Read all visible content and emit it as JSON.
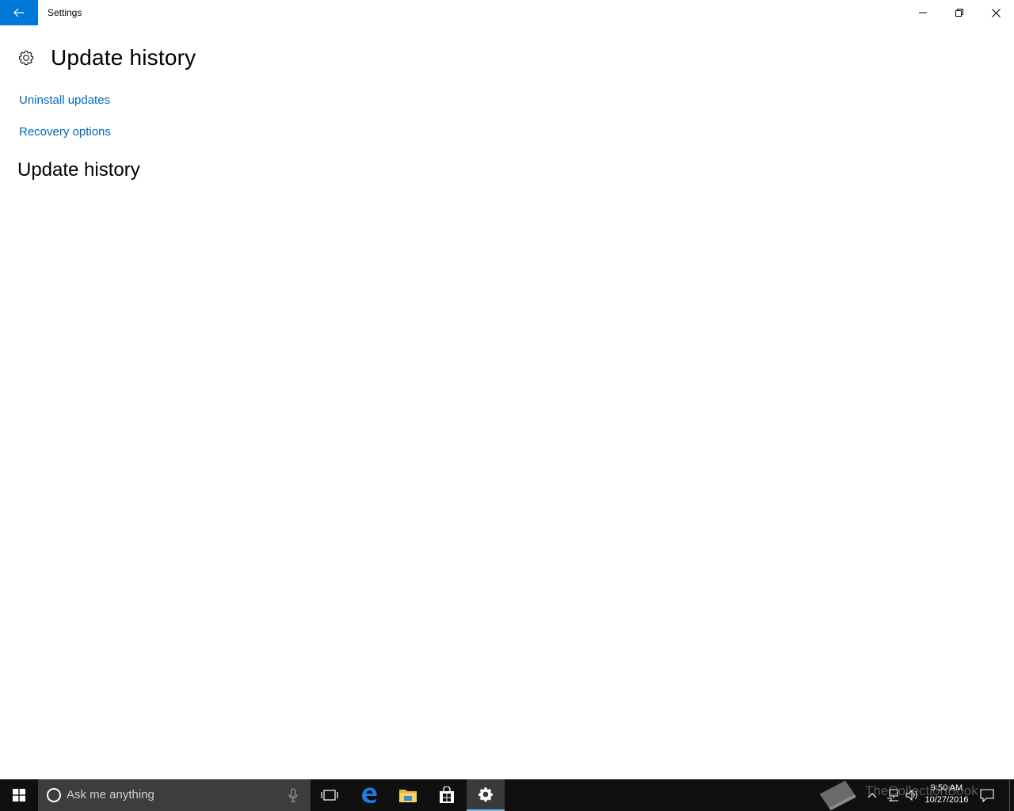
{
  "window": {
    "title": "Settings"
  },
  "page": {
    "title": "Update history",
    "links": {
      "uninstall": "Uninstall updates",
      "recovery": "Recovery options"
    },
    "section_title": "Update history"
  },
  "taskbar": {
    "search_placeholder": "Ask me anything",
    "clock": {
      "time": "9:50 AM",
      "date": "10/27/2016"
    }
  },
  "watermark": {
    "text": "TheCollectionBook"
  },
  "colors": {
    "accent": "#0078d7",
    "link": "#0067b8",
    "taskbar": "#101010"
  }
}
